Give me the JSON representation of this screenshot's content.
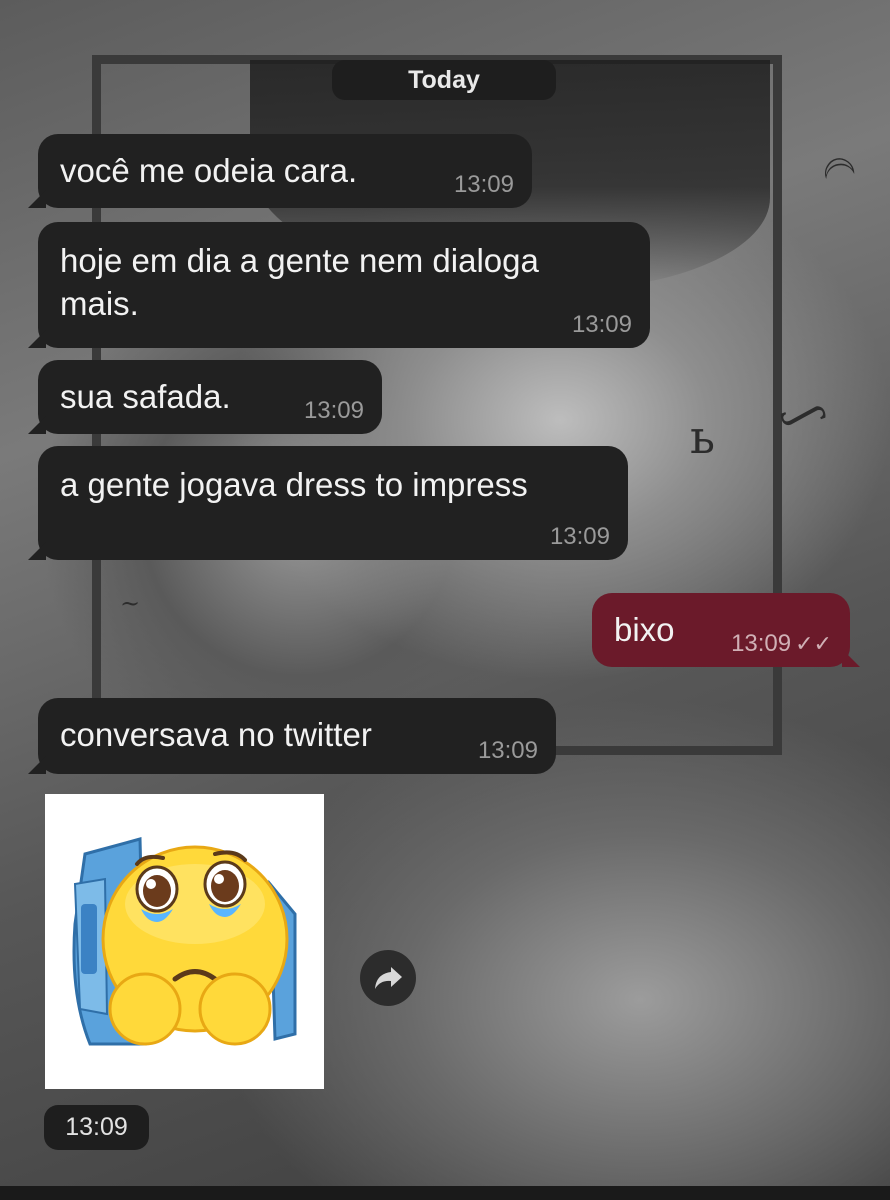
{
  "date_separator": "Today",
  "messages": [
    {
      "text": "você me odeia cara.",
      "time": "13:09",
      "direction": "in"
    },
    {
      "text": "hoje em dia a gente nem dialoga mais.",
      "time": "13:09",
      "direction": "in"
    },
    {
      "text": "sua safada.",
      "time": "13:09",
      "direction": "in"
    },
    {
      "text": "a gente jogava dress to impress",
      "time": "13:09",
      "direction": "in"
    },
    {
      "text": "bixo",
      "time": "13:09",
      "direction": "out",
      "status_icon": "double-check-icon"
    },
    {
      "text": "conversava no twitter",
      "time": "13:09",
      "direction": "in"
    }
  ],
  "sticker": {
    "icon": "pleading-face-sticker",
    "time": "13:09"
  },
  "share_button": {
    "icon": "share-arrow-icon"
  },
  "colors": {
    "incoming_bubble": "#212121",
    "outgoing_bubble": "#6b1a2a",
    "timestamp": "#9a9a9a"
  }
}
